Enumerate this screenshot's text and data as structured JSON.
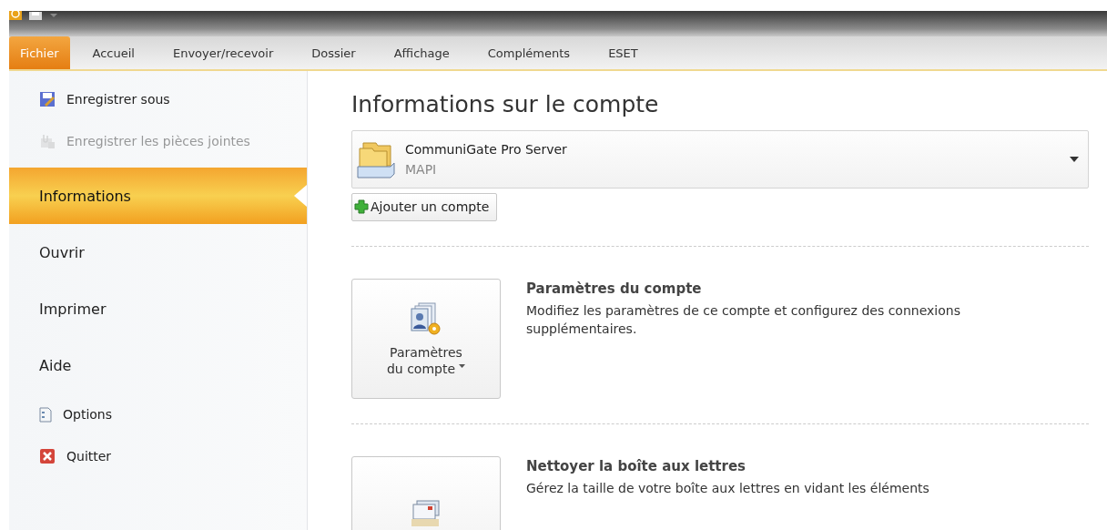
{
  "ribbon_tabs": [
    {
      "label": "Fichier",
      "selected": true
    },
    {
      "label": "Accueil",
      "selected": false
    },
    {
      "label": "Envoyer/recevoir",
      "selected": false
    },
    {
      "label": "Dossier",
      "selected": false
    },
    {
      "label": "Affichage",
      "selected": false
    },
    {
      "label": "Compléments",
      "selected": false
    },
    {
      "label": "ESET",
      "selected": false
    }
  ],
  "sidebar": {
    "items": [
      {
        "label": "Enregistrer sous",
        "kind": "command",
        "disabled": false
      },
      {
        "label": "Enregistrer les pièces jointes",
        "kind": "command",
        "disabled": true
      },
      {
        "label": "Informations",
        "kind": "page",
        "selected": true
      },
      {
        "label": "Ouvrir",
        "kind": "page",
        "selected": false
      },
      {
        "label": "Imprimer",
        "kind": "page",
        "selected": false
      },
      {
        "label": "Aide",
        "kind": "page",
        "selected": false
      },
      {
        "label": "Options",
        "kind": "command",
        "disabled": false
      },
      {
        "label": "Quitter",
        "kind": "command",
        "disabled": false
      }
    ]
  },
  "main": {
    "title": "Informations sur le compte",
    "account": {
      "name": "CommuniGate Pro Server",
      "type": "MAPI"
    },
    "add_account_button": "Ajouter un compte",
    "sections": [
      {
        "button_label": [
          "Paramètres",
          "du compte"
        ],
        "title": "Paramètres du compte",
        "description": "Modifiez les paramètres de ce compte et configurez des connexions supplémentaires."
      },
      {
        "title": "Nettoyer la boîte aux lettres",
        "description": "Gérez la taille de votre boîte aux lettres en vidant les éléments"
      }
    ]
  }
}
